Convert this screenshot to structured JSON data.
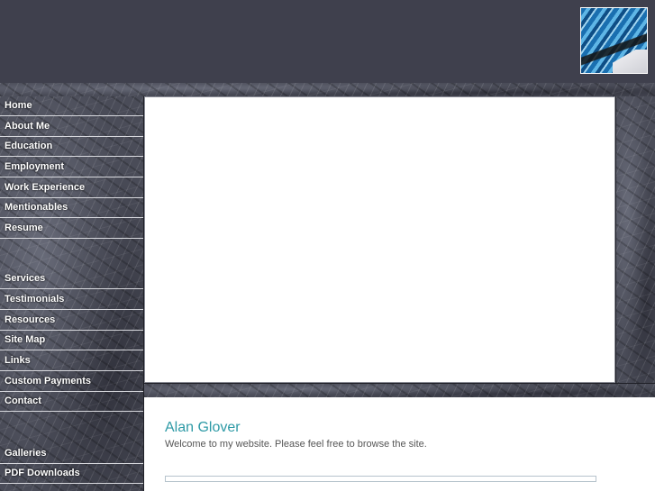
{
  "nav": {
    "group1": [
      "Home",
      "About Me",
      "Education",
      "Employment",
      "Work Experience",
      "Mentionables",
      "Resume"
    ],
    "group2": [
      "Services",
      "Testimonials",
      "Resources",
      "Site Map",
      "Links",
      "Custom Payments",
      "Contact"
    ],
    "group3": [
      "Galleries",
      "PDF Downloads"
    ]
  },
  "content": {
    "title": "Alan Glover",
    "welcome": "Welcome to my website. Please feel free to browse the site."
  },
  "colors": {
    "header_bg": "#3f404d",
    "title": "#2e9aa6",
    "nav_text": "#ffffff"
  }
}
